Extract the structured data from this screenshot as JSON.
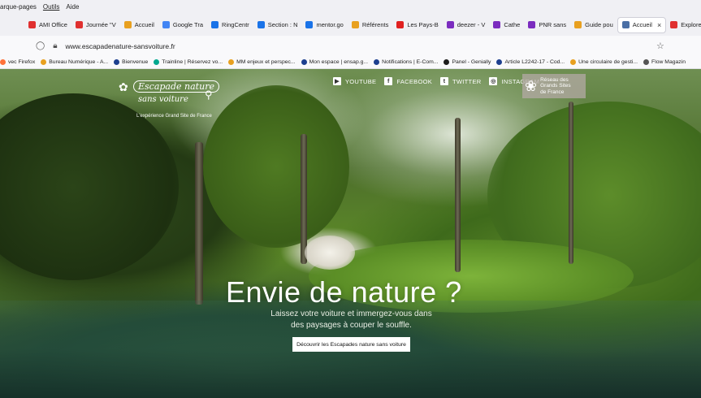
{
  "menubar": {
    "items": [
      "arque-pages",
      "Outils",
      "Aide"
    ]
  },
  "tabs": [
    {
      "label": "AMI Office",
      "color": "#e03030"
    },
    {
      "label": "Journée \"V",
      "color": "#e03030"
    },
    {
      "label": "Accueil",
      "color": "#e8a020"
    },
    {
      "label": "Google Tra",
      "color": "#4285f4"
    },
    {
      "label": "RingCentr",
      "color": "#1a73e8"
    },
    {
      "label": "Section : N",
      "color": "#1a73e8"
    },
    {
      "label": "mentor.go",
      "color": "#1a73e8"
    },
    {
      "label": "Référents",
      "color": "#e8a020"
    },
    {
      "label": "Les Pays-B",
      "color": "#e02020"
    },
    {
      "label": "deezer - V",
      "color": "#7b2cbf"
    },
    {
      "label": "Cathe",
      "color": "#7b2cbf"
    },
    {
      "label": "PNR sans",
      "color": "#7b2cbf"
    },
    {
      "label": "Guide pou",
      "color": "#e8a020"
    },
    {
      "label": "Accueil",
      "color": "#4a6fa5",
      "active": true,
      "close": "×"
    },
    {
      "label": "Explorer l",
      "color": "#e03030"
    }
  ],
  "urlbar": {
    "url": "www.escapadenature-sansvoiture.fr"
  },
  "bookmarks": [
    {
      "label": "vec Firefox",
      "color": "#ff7139"
    },
    {
      "label": "Bureau Numérique - A...",
      "color": "#e8a020"
    },
    {
      "label": "Bienvenue",
      "color": "#1d3f8f"
    },
    {
      "label": "Trainline | Réservez vo...",
      "color": "#00a88f"
    },
    {
      "label": "MM enjeux et perspec...",
      "color": "#e8a020"
    },
    {
      "label": "Mon espace | ensap.g...",
      "color": "#1d3f8f"
    },
    {
      "label": "Notifications | E-Com...",
      "color": "#1d3f8f"
    },
    {
      "label": "Panel - Genially",
      "color": "#1d1d1d"
    },
    {
      "label": "Article L2242-17 - Cod...",
      "color": "#1d3f8f"
    },
    {
      "label": "Une circulaire de gesti...",
      "color": "#e8a020"
    },
    {
      "label": "Flow Magazin",
      "color": "#555555"
    }
  ],
  "logo": {
    "line1": "Escapade nature",
    "line2": "sans voiture",
    "tagline": "L'expérience Grand Site de France"
  },
  "social": [
    {
      "label": "YOUTUBE",
      "icon": "youtube-icon",
      "glyph": "▶"
    },
    {
      "label": "FACEBOOK",
      "icon": "facebook-icon",
      "glyph": "f"
    },
    {
      "label": "TWITTER",
      "icon": "twitter-icon",
      "glyph": "t"
    },
    {
      "label": "INSTAGRAM",
      "icon": "instagram-icon",
      "glyph": "◎"
    }
  ],
  "network_badge": {
    "line1": "Réseau des",
    "line2": "Grands Sites",
    "line3": "de France"
  },
  "hero": {
    "headline": "Envie de nature ?",
    "subline": "Laissez votre voiture et immergez-vous dans des paysages à couper le souffle.",
    "cta": "Découvrir les Escapades nature sans voiture"
  }
}
